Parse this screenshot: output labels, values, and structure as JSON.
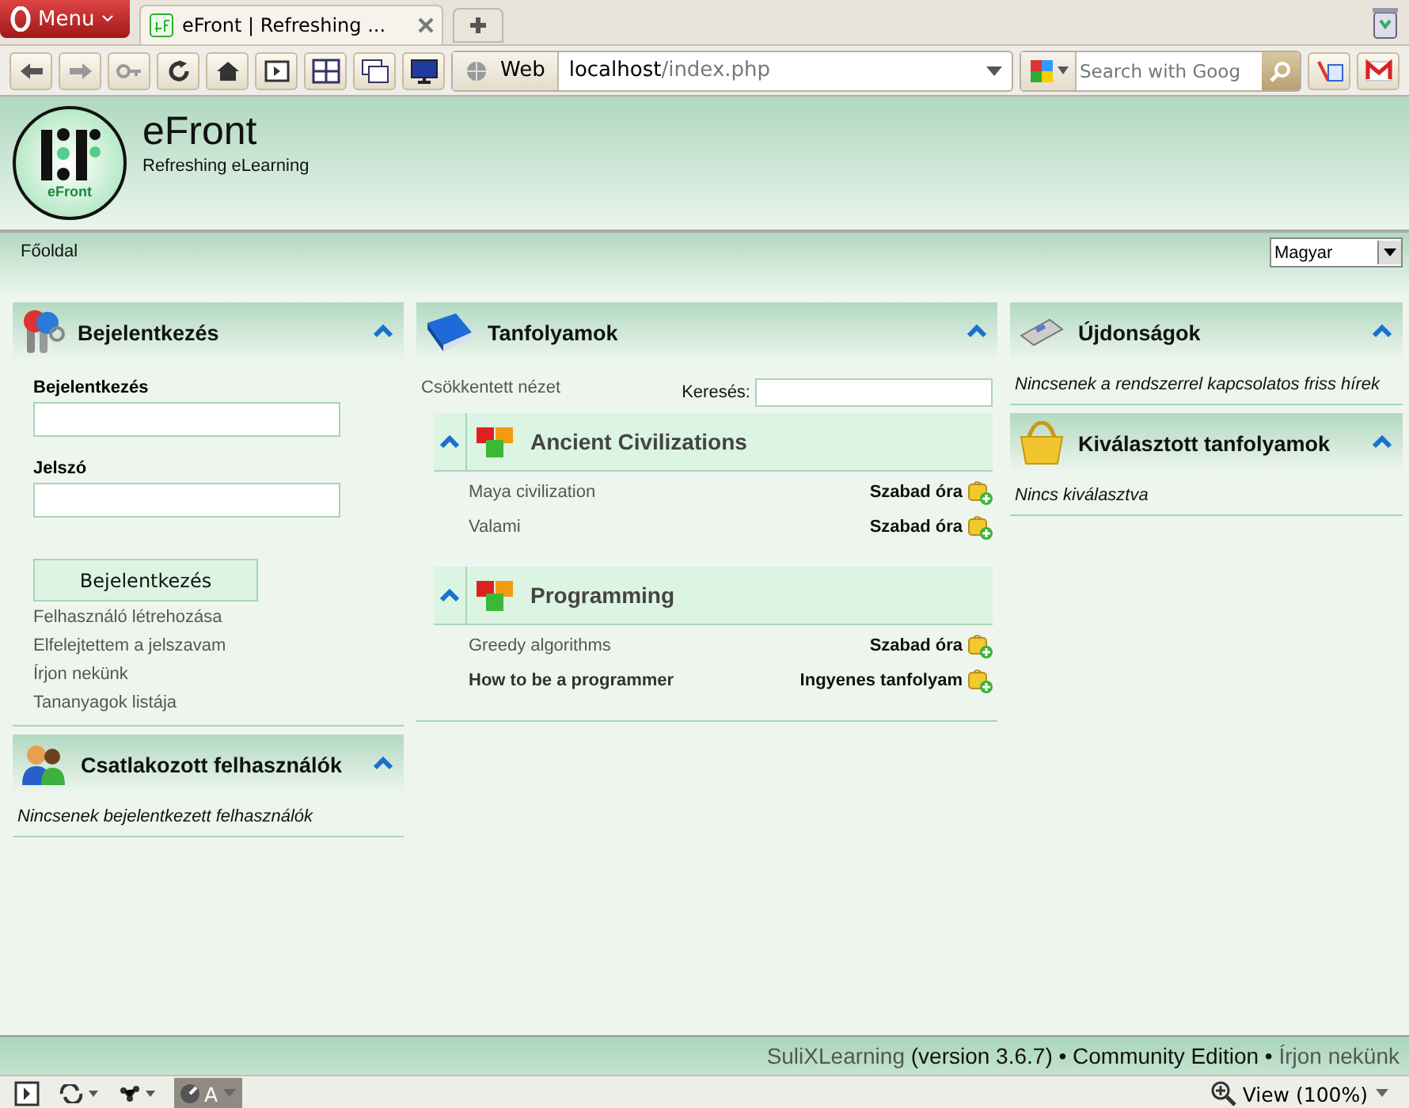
{
  "browser": {
    "menu_label": "Menu",
    "tabs": [
      {
        "title": "eFront | Refreshing ...",
        "selected": true
      }
    ],
    "address": {
      "scheme_label": "Web",
      "host": "localhost",
      "path": "/index.php"
    },
    "search": {
      "placeholder": "Search with Goog"
    }
  },
  "header": {
    "logo_text": "eFront",
    "title": "eFront",
    "subtitle": "Refreshing eLearning"
  },
  "nav": {
    "items": [
      "Főoldal"
    ],
    "language": "Magyar"
  },
  "columns": [
    {
      "panels": [
        {
          "kind": "login",
          "title": "Bejelentkezés",
          "expanded": true,
          "fields": [
            {
              "label": "Bejelentkezés"
            },
            {
              "label": "Jelszó"
            }
          ],
          "button": "Bejelentkezés",
          "links": [
            "Felhasználó létrehozása",
            "Elfelejtettem a jelszavam",
            "Írjon nekünk",
            "Tananyagok listája"
          ]
        },
        {
          "kind": "users",
          "title": "Csatlakozott felhasználók",
          "expanded": true,
          "message": "Nincsenek bejelentkezett felhasználók"
        }
      ]
    },
    {
      "panels": [
        {
          "kind": "courses",
          "title": "Tanfolyamok",
          "expanded": true,
          "view_link": "Csökkentett nézet",
          "search_label": "Keresés:",
          "categories": [
            {
              "name": "Ancient Civilizations",
              "expanded": true,
              "items": [
                {
                  "kind": "lesson",
                  "name": "Maya civilization",
                  "action": "Szabad óra"
                },
                {
                  "kind": "lesson",
                  "name": "Valami",
                  "action": "Szabad óra"
                }
              ]
            },
            {
              "name": "Programming",
              "expanded": true,
              "items": [
                {
                  "kind": "lesson",
                  "name": "Greedy algorithms",
                  "action": "Szabad óra"
                },
                {
                  "kind": "course",
                  "name": "How to be a programmer",
                  "action": "Ingyenes tanfolyam"
                }
              ]
            }
          ]
        }
      ]
    },
    {
      "panels": [
        {
          "kind": "news",
          "title": "Újdonságok",
          "expanded": true,
          "message": "Nincsenek a rendszerrel kapcsolatos friss hírek"
        },
        {
          "kind": "cart",
          "title": "Kiválasztott tanfolyamok",
          "expanded": true,
          "message": "Nincs kiválasztva"
        }
      ]
    }
  ],
  "footer": {
    "product": "SuliXLearning",
    "edition": "(version 3.6.7) • Community Edition •",
    "contact": "Írjon nekünk"
  },
  "statusbar": {
    "font_label": "A",
    "zoom": "View (100%)"
  }
}
